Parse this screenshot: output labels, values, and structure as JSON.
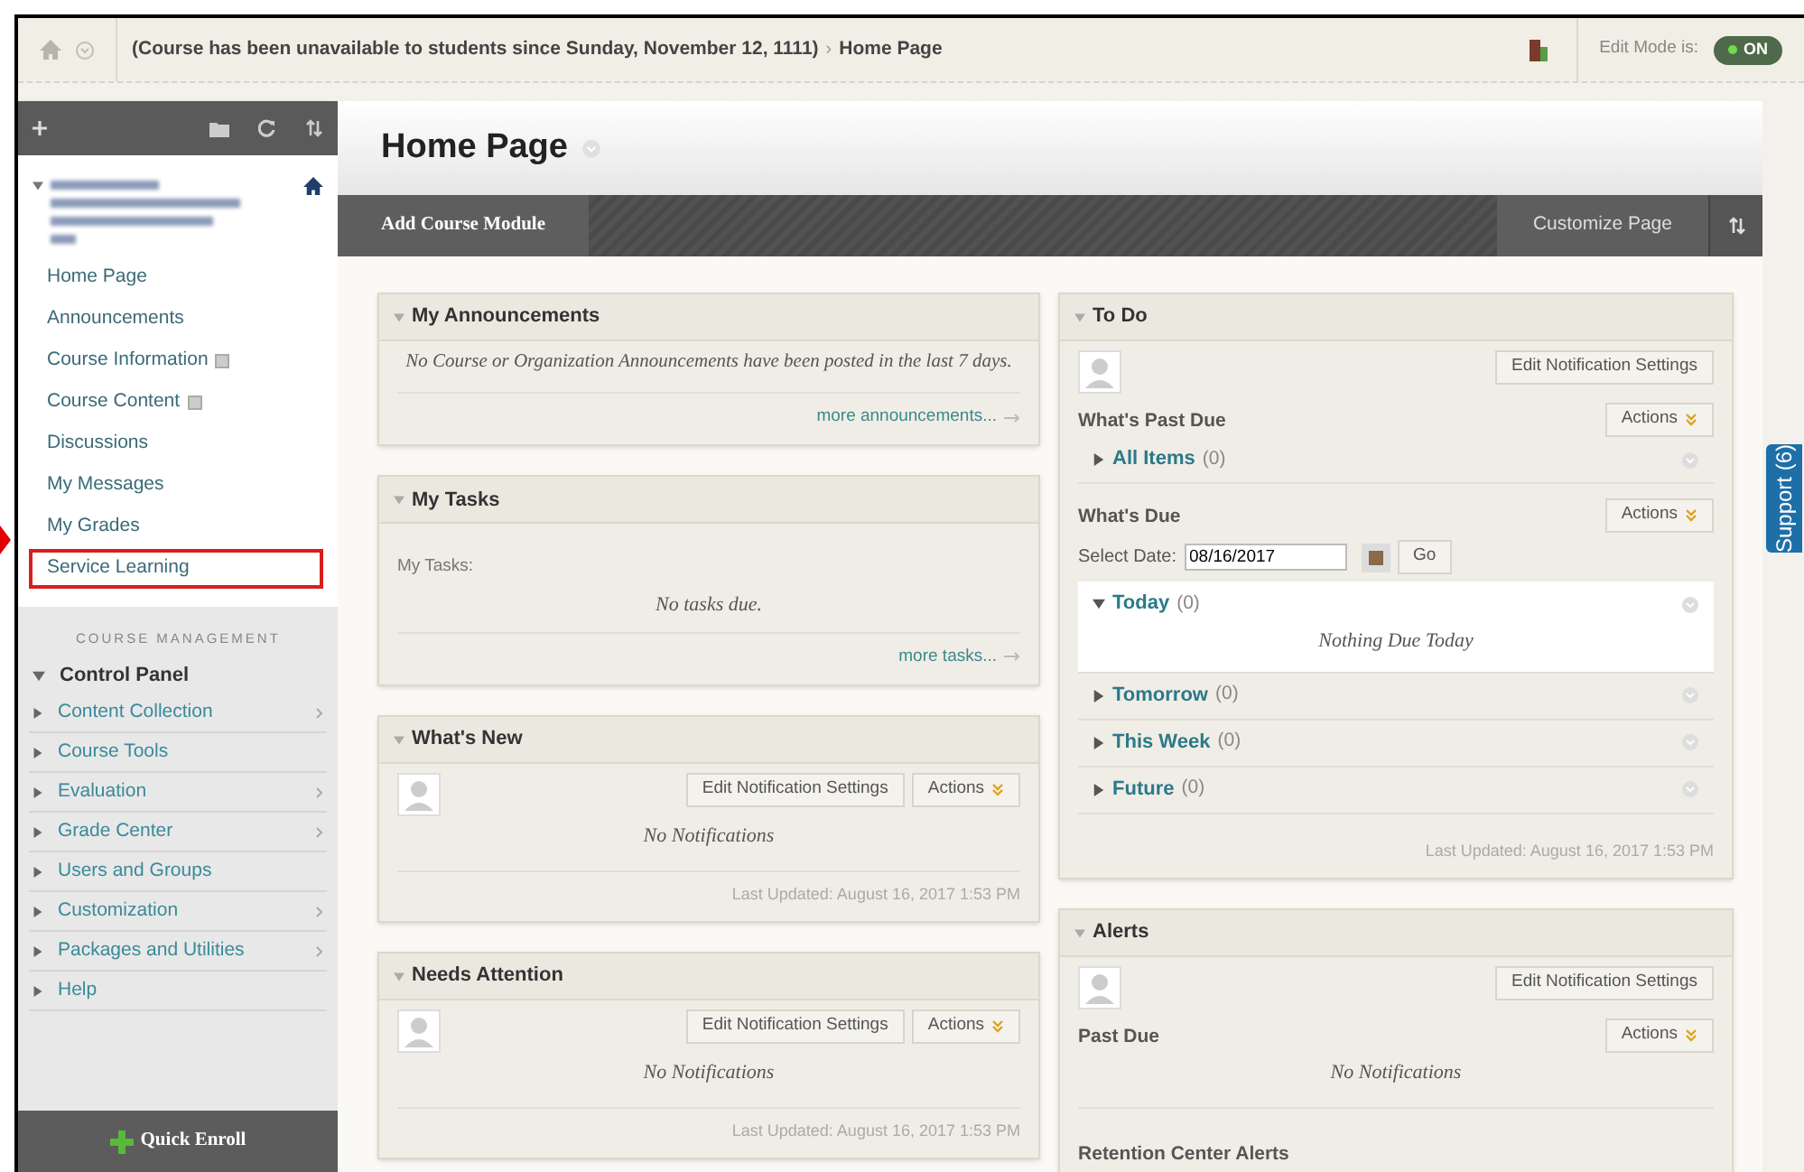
{
  "breadcrumb": {
    "status": "(Course has been unavailable to students since Sunday, November 12, 1111)",
    "separator": "›",
    "current": "Home Page"
  },
  "edit_mode": {
    "label": "Edit Mode is:",
    "toggle": "ON",
    "on": true
  },
  "sidebar": {
    "course_menu": [
      {
        "label": "Home Page",
        "has_icon": false,
        "highlighted": false
      },
      {
        "label": "Announcements",
        "has_icon": false,
        "highlighted": false
      },
      {
        "label": "Course Information",
        "has_icon": true,
        "highlighted": false
      },
      {
        "label": "Course Content",
        "has_icon": true,
        "highlighted": false
      },
      {
        "label": "Discussions",
        "has_icon": false,
        "highlighted": false
      },
      {
        "label": "My Messages",
        "has_icon": false,
        "highlighted": false
      },
      {
        "label": "My Grades",
        "has_icon": false,
        "highlighted": false
      },
      {
        "label": "Service Learning",
        "has_icon": false,
        "highlighted": true
      }
    ],
    "section_title": "COURSE MANAGEMENT",
    "control_panel": {
      "label": "Control Panel",
      "expanded": true,
      "items": [
        {
          "label": "Content Collection",
          "has_submenu": true
        },
        {
          "label": "Course Tools",
          "has_submenu": false
        },
        {
          "label": "Evaluation",
          "has_submenu": true
        },
        {
          "label": "Grade Center",
          "has_submenu": true
        },
        {
          "label": "Users and Groups",
          "has_submenu": false
        },
        {
          "label": "Customization",
          "has_submenu": true
        },
        {
          "label": "Packages and Utilities",
          "has_submenu": true
        },
        {
          "label": "Help",
          "has_submenu": false
        }
      ]
    },
    "quick_enroll": "Quick Enroll"
  },
  "page_title": "Home Page",
  "toolbar": {
    "add": "Add Course Module",
    "customize": "Customize Page"
  },
  "left_modules": [
    {
      "kind": "message",
      "title": "My Announcements",
      "message": "No Course or Organization Announcements have been posted in the last 7 days.",
      "link": "more announcements..."
    },
    {
      "kind": "tasks",
      "title": "My Tasks",
      "label": "My Tasks:",
      "message": "No tasks due.",
      "link": "more tasks..."
    },
    {
      "kind": "notifications",
      "title": "What's New",
      "settings": "Edit Notification Settings",
      "actions": "Actions",
      "message": "No Notifications",
      "updated": "Last Updated: August 16, 2017 1:53 PM"
    },
    {
      "kind": "notifications",
      "title": "Needs Attention",
      "settings": "Edit Notification Settings",
      "actions": "Actions",
      "message": "No Notifications",
      "updated": "Last Updated: August 16, 2017 1:53 PM"
    }
  ],
  "right_modules": [
    {
      "kind": "todo",
      "title": "To Do",
      "settings": "Edit Notification Settings",
      "past_due": {
        "heading": "What's Past Due",
        "actions": "Actions",
        "groups": [
          {
            "label": "All Items",
            "count": "(0)",
            "expanded": false
          }
        ]
      },
      "due": {
        "heading": "What's Due",
        "actions": "Actions",
        "date_label": "Select Date:",
        "date_value": "08/16/2017",
        "go": "Go",
        "groups": [
          {
            "label": "Today",
            "count": "(0)",
            "expanded": true,
            "message": "Nothing Due Today"
          },
          {
            "label": "Tomorrow",
            "count": "(0)",
            "expanded": false
          },
          {
            "label": "This Week",
            "count": "(0)",
            "expanded": false
          },
          {
            "label": "Future",
            "count": "(0)",
            "expanded": false
          }
        ]
      },
      "updated": "Last Updated: August 16, 2017 1:53 PM"
    },
    {
      "kind": "alerts",
      "title": "Alerts",
      "settings": "Edit Notification Settings",
      "heading": "Past Due",
      "actions": "Actions",
      "message": "No Notifications",
      "subheading": "Retention Center Alerts"
    }
  ],
  "support_tab": "Support (6)"
}
